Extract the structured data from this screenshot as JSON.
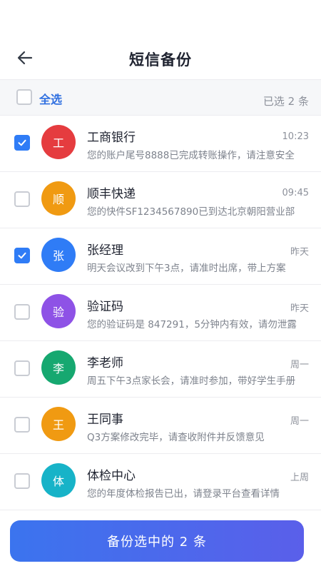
{
  "header": {
    "title": "短信备份",
    "back_icon": "back-arrow-icon"
  },
  "select_bar": {
    "select_all_label": "全选",
    "selected_count_text": "已选 2 条"
  },
  "messages": [
    {
      "avatar_char": "工",
      "avatar_color": "#e53c3f",
      "sender": "工商银行",
      "time": "10:23",
      "preview": "您的账户尾号8888已完成转账操作，请注意安全",
      "checked": true
    },
    {
      "avatar_char": "顺",
      "avatar_color": "#f09a12",
      "sender": "顺丰快递",
      "time": "09:45",
      "preview": "您的快件SF1234567890已到达北京朝阳营业部",
      "checked": false
    },
    {
      "avatar_char": "张",
      "avatar_color": "#2f7cf6",
      "sender": "张经理",
      "time": "昨天",
      "preview": "明天会议改到下午3点，请准时出席，带上方案",
      "checked": true
    },
    {
      "avatar_char": "验",
      "avatar_color": "#8e52e6",
      "sender": "验证码",
      "time": "昨天",
      "preview": "您的验证码是 847291，5分钟内有效，请勿泄露",
      "checked": false
    },
    {
      "avatar_char": "李",
      "avatar_color": "#16a870",
      "sender": "李老师",
      "time": "周一",
      "preview": "周五下午3点家长会，请准时参加，带好学生手册",
      "checked": false
    },
    {
      "avatar_char": "王",
      "avatar_color": "#f09a12",
      "sender": "王同事",
      "time": "周一",
      "preview": "Q3方案修改完毕，请查收附件并反馈意见",
      "checked": false
    },
    {
      "avatar_char": "体",
      "avatar_color": "#17b3c8",
      "sender": "体检中心",
      "time": "上周",
      "preview": "您的年度体检报告已出，请登录平台查看详情",
      "checked": false
    }
  ],
  "action_button": {
    "label": "备份选中的 2 条"
  },
  "colors": {
    "accent": "#2f7cf6",
    "button_gradient_start": "#3b74ee",
    "button_gradient_end": "#5a5fea"
  }
}
